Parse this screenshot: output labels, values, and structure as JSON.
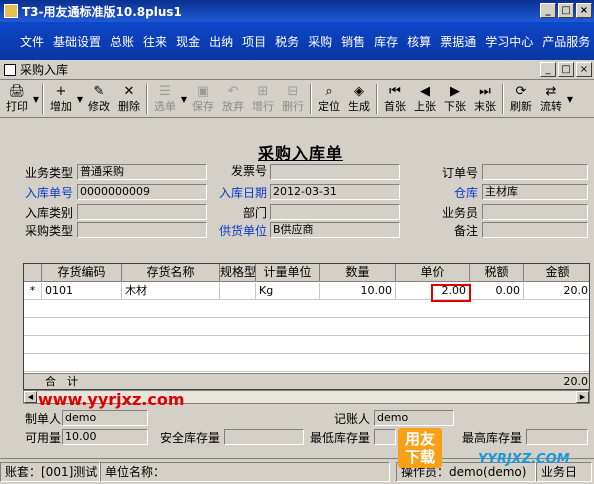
{
  "window": {
    "title": "T3-用友通标准版10.8plus1",
    "minimize": "_",
    "maximize": "□",
    "close": "×"
  },
  "menu": [
    "文件",
    "基础设置",
    "总账",
    "往来",
    "现金",
    "出纳",
    "项目",
    "税务",
    "采购",
    "销售",
    "库存",
    "核算",
    "票据通",
    "学习中心",
    "产品服务"
  ],
  "subwindow": {
    "title": "采购入库",
    "minimize": "_",
    "restore": "□",
    "close": "×"
  },
  "toolbar": [
    {
      "label": "打印",
      "icon": "printer-icon",
      "glyph": "🖨",
      "enabled": true,
      "dropdown": true
    },
    {
      "label": "增加",
      "icon": "add-icon",
      "glyph": "+",
      "enabled": true,
      "dropdown": true
    },
    {
      "label": "修改",
      "icon": "edit-icon",
      "glyph": "✎",
      "enabled": true
    },
    {
      "label": "删除",
      "icon": "delete-icon",
      "glyph": "✕",
      "enabled": true
    },
    {
      "label": "选单",
      "icon": "select-icon",
      "glyph": "☰",
      "enabled": false,
      "dropdown": true
    },
    {
      "label": "保存",
      "icon": "save-icon",
      "glyph": "▣",
      "enabled": false
    },
    {
      "label": "放弃",
      "icon": "discard-icon",
      "glyph": "↶",
      "enabled": false
    },
    {
      "label": "增行",
      "icon": "add-row-icon",
      "glyph": "⊞",
      "enabled": false
    },
    {
      "label": "删行",
      "icon": "delete-row-icon",
      "glyph": "⊟",
      "enabled": false
    },
    {
      "label": "定位",
      "icon": "locate-icon",
      "glyph": "⌕",
      "enabled": true
    },
    {
      "label": "生成",
      "icon": "generate-icon",
      "glyph": "◈",
      "enabled": true
    },
    {
      "label": "首张",
      "icon": "first-icon",
      "glyph": "⏮",
      "enabled": true
    },
    {
      "label": "上张",
      "icon": "prev-icon",
      "glyph": "◀",
      "enabled": true
    },
    {
      "label": "下张",
      "icon": "next-icon",
      "glyph": "▶",
      "enabled": true
    },
    {
      "label": "末张",
      "icon": "last-icon",
      "glyph": "⏭",
      "enabled": true
    },
    {
      "label": "刷新",
      "icon": "refresh-icon",
      "glyph": "⟳",
      "enabled": true
    },
    {
      "label": "流转",
      "icon": "flow-icon",
      "glyph": "⇄",
      "enabled": true,
      "dropdown": true
    }
  ],
  "form": {
    "title": "采购入库单",
    "biz_type": {
      "label": "业务类型",
      "value": "普通采购"
    },
    "invoice_no": {
      "label": "发票号",
      "value": ""
    },
    "order_no": {
      "label": "订单号",
      "value": ""
    },
    "receipt_no": {
      "label": "入库单号",
      "value": "0000000009"
    },
    "receipt_date": {
      "label": "入库日期",
      "value": "2012-03-31"
    },
    "warehouse": {
      "label": "仓库",
      "value": "主材库"
    },
    "receipt_cat": {
      "label": "入库类别",
      "value": ""
    },
    "department": {
      "label": "部门",
      "value": ""
    },
    "salesperson": {
      "label": "业务员",
      "value": ""
    },
    "purchase_type": {
      "label": "采购类型",
      "value": ""
    },
    "supplier": {
      "label": "供货单位",
      "value": "B供应商"
    },
    "remark": {
      "label": "备注",
      "value": ""
    }
  },
  "grid": {
    "columns": [
      "存货编码",
      "存货名称",
      "规格型号",
      "计量单位",
      "数量",
      "单价",
      "税额",
      "金额"
    ],
    "rows": [
      {
        "marker": "*",
        "code": "0101",
        "name": "木材",
        "spec": "",
        "unit": "Kg",
        "qty": "10.00",
        "price": "2.00",
        "tax": "0.00",
        "amount": "20.0"
      }
    ],
    "sum_label": "合　计",
    "sum_amount": "20.0"
  },
  "footer": {
    "maker": {
      "label": "制单人",
      "value": "demo"
    },
    "bookkeeper": {
      "label": "记账人",
      "value": "demo"
    },
    "available": {
      "label": "可用量",
      "value": "10.00"
    },
    "safety": {
      "label": "安全库存量",
      "value": ""
    },
    "min_stock": {
      "label": "最低库存量",
      "value": ""
    },
    "max_stock": {
      "label": "最高库存量",
      "value": ""
    }
  },
  "status": {
    "account": "账套：[001]测试",
    "unit": "单位名称：",
    "operator": "操作员：demo(demo)",
    "tail": "业务日"
  },
  "watermark": {
    "site": "www.yyrjxz.com",
    "logo_top": "用友",
    "logo_bottom": "下载",
    "logo_site": "YYRJXZ.COM"
  },
  "colors": {
    "title_bar": "#0a2f8f",
    "menu_bar": "#0c46c8",
    "label_blue": "#0a3bc8",
    "highlight_red": "#e00000"
  }
}
